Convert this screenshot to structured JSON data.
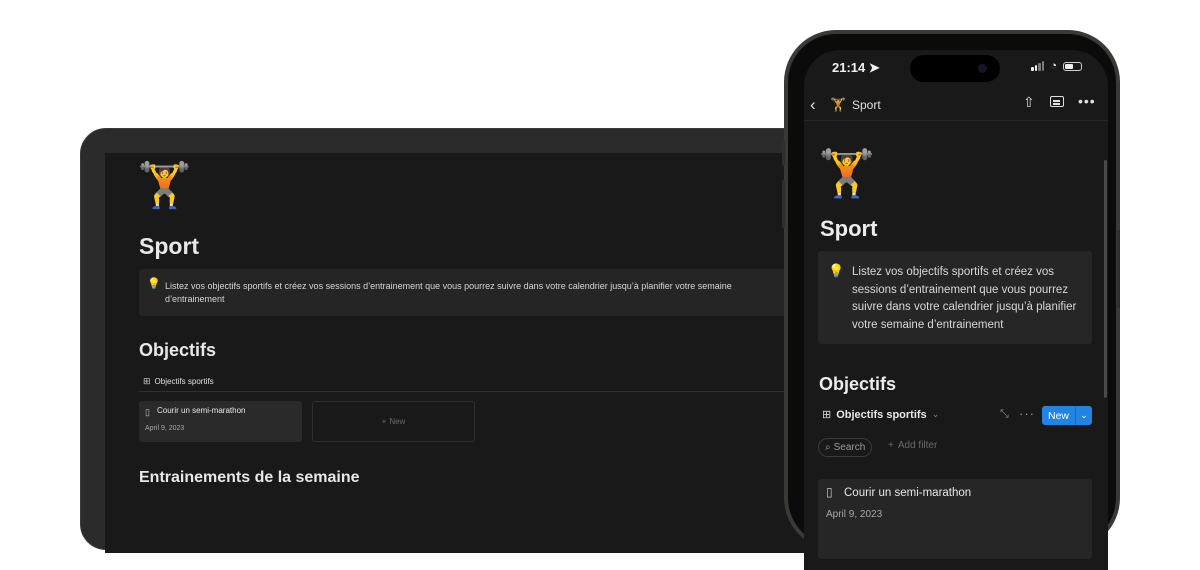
{
  "laptop": {
    "page_emoji": "🏋️",
    "page_title": "Sport",
    "callout_icon": "💡",
    "callout_text": "Listez vos objectifs sportifs et créez vos sessions d’entrainement que vous pourrez suivre dans votre calendrier jusqu’à planifier votre semaine d’entrainement",
    "section_objectifs": "Objectifs",
    "view_tab": "Objectifs sportifs",
    "cards": [
      {
        "title": "Courir un semi-marathon",
        "date": "April 9, 2023"
      }
    ],
    "new_card_label": "New",
    "section_entrainements": "Entrainements de la semaine"
  },
  "phone": {
    "status": {
      "time": "21:14"
    },
    "nav": {
      "back_icon": "chevron-left-icon",
      "page_emoji": "🏋️",
      "title": "Sport"
    },
    "page_emoji": "🏋️",
    "page_title": "Sport",
    "callout_icon": "💡",
    "callout_text": "Listez vos objectifs sportifs et créez vos sessions d’entrainement que vous pourrez suivre dans votre calendrier jusqu’à planifier votre semaine d’entrainement",
    "section_objectifs": "Objectifs",
    "view_label": "Objectifs sportifs",
    "new_button": "New",
    "search_label": "Search",
    "filter_label": "Add filter",
    "cards": [
      {
        "title": "Courir un semi-marathon",
        "date": "April 9, 2023"
      }
    ]
  },
  "colors": {
    "accent": "#2383e2",
    "background": "#191919",
    "callout": "#252525"
  }
}
